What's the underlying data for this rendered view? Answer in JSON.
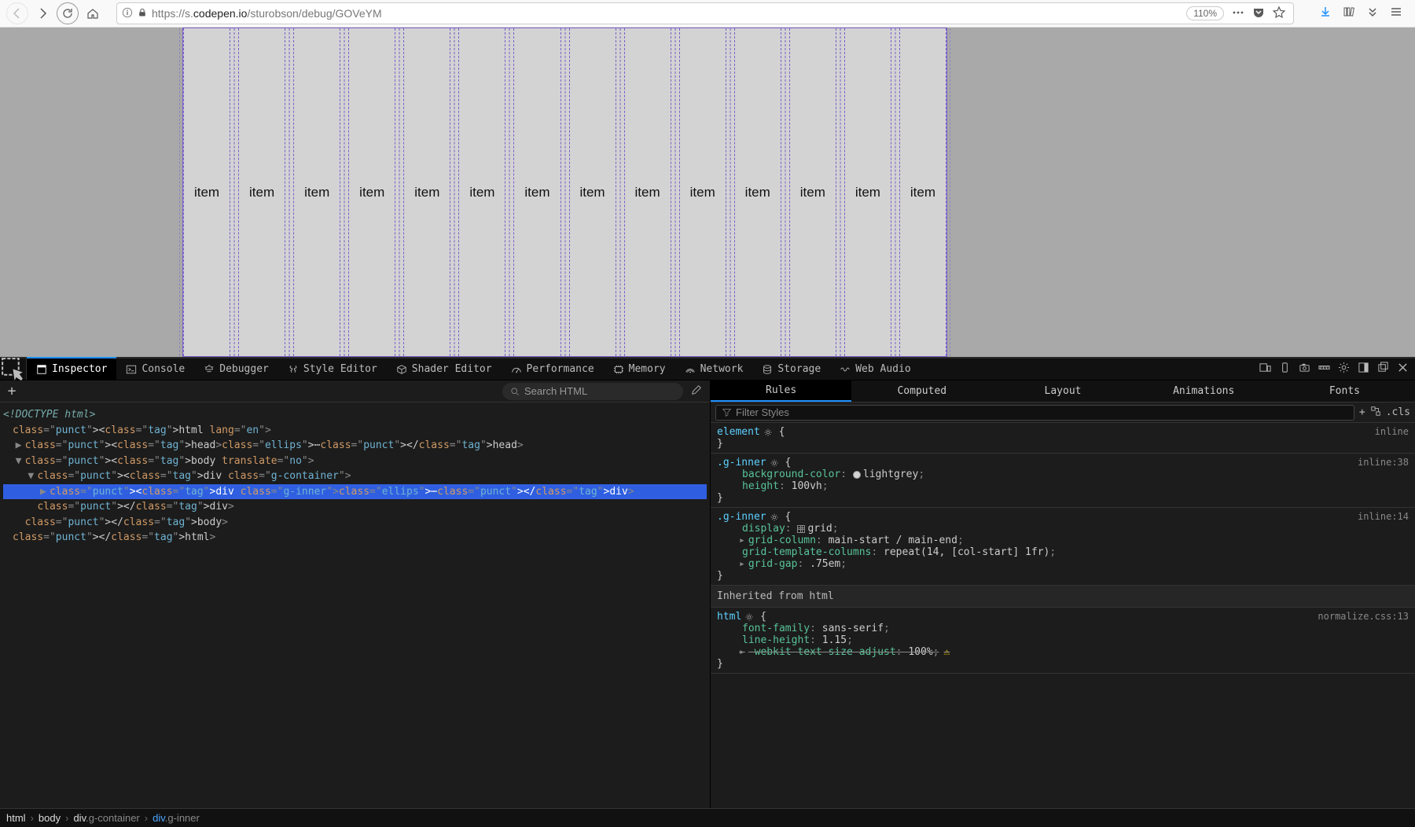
{
  "browser": {
    "url_prefix": "https://s.",
    "url_domain": "codepen.io",
    "url_path": "/sturobson/debug/GOVeYM",
    "zoom": "110%"
  },
  "page": {
    "item_label": "item",
    "item_count": 14
  },
  "devtools": {
    "tabs": [
      "Inspector",
      "Console",
      "Debugger",
      "Style Editor",
      "Shader Editor",
      "Performance",
      "Memory",
      "Network",
      "Storage",
      "Web Audio"
    ],
    "active_tab": "Inspector",
    "search_placeholder": "Search HTML",
    "dom": {
      "doctype": "<!DOCTYPE html>",
      "lines": [
        {
          "depth": 0,
          "html": "<html lang=\"en\">",
          "twisty": ""
        },
        {
          "depth": 1,
          "html": "<head>…</head>",
          "twisty": "▶"
        },
        {
          "depth": 1,
          "html": "<body translate=\"no\">",
          "twisty": "▼"
        },
        {
          "depth": 2,
          "html": "<div class=\"g-container\">",
          "twisty": "▼"
        },
        {
          "depth": 3,
          "html": "<div class=\"g-inner\">…</div>",
          "twisty": "▶",
          "selected": true
        },
        {
          "depth": 2,
          "html": "</div>"
        },
        {
          "depth": 1,
          "html": "</body>"
        },
        {
          "depth": 0,
          "html": "</html>"
        }
      ]
    },
    "breadcrumb": [
      "html",
      "body",
      "div.g-container",
      "div.g-inner"
    ],
    "rules_tabs": [
      "Rules",
      "Computed",
      "Layout",
      "Animations",
      "Fonts"
    ],
    "active_rules_tab": "Rules",
    "filter_placeholder": "Filter Styles",
    "cls_label": ".cls",
    "rules": [
      {
        "selector": "element",
        "gear": true,
        "source": "inline",
        "props": []
      },
      {
        "selector": ".g-inner",
        "gear": true,
        "source": "inline:38",
        "props": [
          {
            "name": "background-color",
            "value": "lightgrey",
            "swatch": true
          },
          {
            "name": "height",
            "value": "100vh"
          }
        ]
      },
      {
        "selector": ".g-inner",
        "gear": true,
        "source": "inline:14",
        "props": [
          {
            "name": "display",
            "value": "grid",
            "gridswatch": true
          },
          {
            "name": "grid-column",
            "value": "main-start / main-end",
            "expand": true
          },
          {
            "name": "grid-template-columns",
            "value": "repeat(14, [col-start] 1fr)"
          },
          {
            "name": "grid-gap",
            "value": ".75em",
            "expand": true
          }
        ]
      }
    ],
    "inherited_label": "Inherited from html",
    "inherited_rule": {
      "selector": "html",
      "gear": true,
      "source": "normalize.css:13",
      "props": [
        {
          "name": "font-family",
          "value": "sans-serif"
        },
        {
          "name": "line-height",
          "value": "1.15"
        },
        {
          "name": "-webkit-text-size-adjust",
          "value": "100%",
          "strike": true,
          "expand": true,
          "warn": true
        }
      ]
    }
  }
}
